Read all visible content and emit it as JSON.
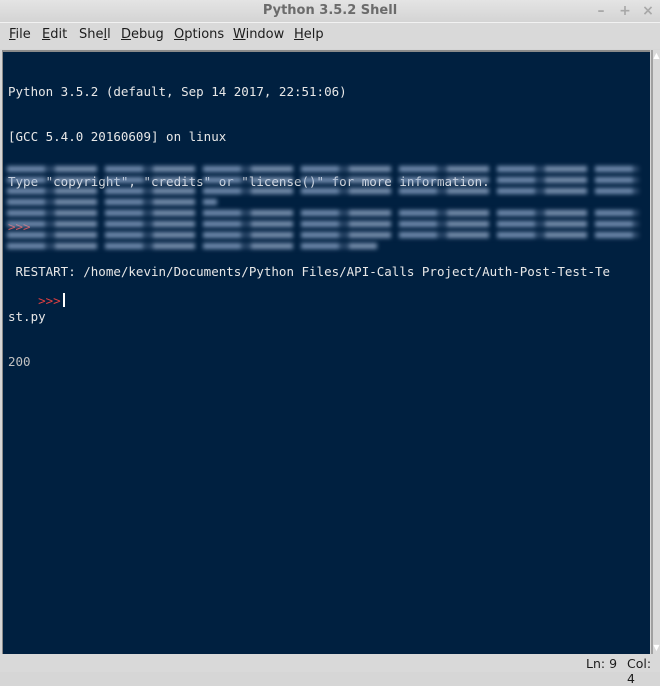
{
  "window": {
    "title": "Python 3.5.2 Shell",
    "controls": {
      "minimize_icon": "–",
      "maximize_icon": "+",
      "close_icon": "×"
    }
  },
  "menu": {
    "items": [
      {
        "label": "File",
        "mnemonic": "F",
        "rest": "ile"
      },
      {
        "label": "Edit",
        "mnemonic": "E",
        "rest": "dit"
      },
      {
        "label": "Shell",
        "pre": "She",
        "mnemonic": "l",
        "rest": "l"
      },
      {
        "label": "Debug",
        "mnemonic": "D",
        "rest": "ebug"
      },
      {
        "label": "Options",
        "mnemonic": "O",
        "rest": "ptions"
      },
      {
        "label": "Window",
        "mnemonic": "W",
        "rest": "indow"
      },
      {
        "label": "Help",
        "mnemonic": "H",
        "rest": "elp"
      }
    ]
  },
  "shell": {
    "banner_line1": "Python 3.5.2 (default, Sep 14 2017, 22:51:06)",
    "banner_line2": "[GCC 5.4.0 20160609] on linux",
    "banner_line3": "Type \"copyright\", \"credits\" or \"license()\" for more information.",
    "prompt": ">>>",
    "restart_line1": " RESTART: /home/kevin/Documents/Python Files/API-Calls Project/Auth-Post-Test-Te",
    "restart_line2": "st.py",
    "output_status": "200",
    "redacted_output": "[redacted output]",
    "final_prompt": ">>>"
  },
  "statusbar": {
    "line": "Ln: 9",
    "col": "Col: 4"
  },
  "colors": {
    "editor_background": "#002040",
    "prompt_color": "#e04040",
    "text_color": "#e8e8e8"
  }
}
